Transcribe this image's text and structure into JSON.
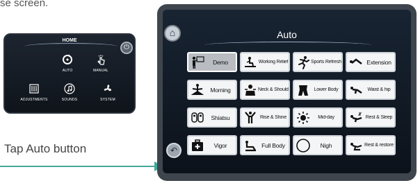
{
  "doc": {
    "top_text": "se screen.",
    "caption": "Tap Auto button"
  },
  "home_screen": {
    "title": "HOME",
    "items": [
      {
        "label": "AUTO",
        "icon": "refresh-icon"
      },
      {
        "label": "MANUAL",
        "icon": "hand-tap-icon"
      },
      {
        "label": "ADJUSTMENTS",
        "icon": "sliders-icon"
      },
      {
        "label": "SOUNDS",
        "icon": "music-note-icon"
      },
      {
        "label": "SYSTEM",
        "icon": "fan-icon"
      }
    ]
  },
  "auto_screen": {
    "title": "Auto",
    "programs": [
      {
        "label": "Demo",
        "icon": "presenter-icon",
        "selected": true
      },
      {
        "label": "Working Relief",
        "icon": "worker-icon"
      },
      {
        "label": "Sports Refresh",
        "icon": "runner-icon"
      },
      {
        "label": "Extension",
        "icon": "stretch-icon"
      },
      {
        "label": "Morning",
        "icon": "yoga-icon"
      },
      {
        "label": "Neck & Shoulder",
        "icon": "neck-shoulder-icon"
      },
      {
        "label": "Lower Body",
        "icon": "lower-body-icon"
      },
      {
        "label": "Waist & hip",
        "icon": "waist-hip-icon"
      },
      {
        "label": "Shiatsu",
        "icon": "fingers-icon"
      },
      {
        "label": "Rise & Shine",
        "icon": "rise-shine-icon"
      },
      {
        "label": "Mid-day",
        "icon": "sun-icon"
      },
      {
        "label": "Rest & Sleep",
        "icon": "sleep-icon"
      },
      {
        "label": "Vigor",
        "icon": "first-aid-icon"
      },
      {
        "label": "Full Body",
        "icon": "full-body-icon"
      },
      {
        "label": "Nigh",
        "icon": "moon-icon"
      },
      {
        "label": "Rest & restore",
        "icon": "recline-icon"
      }
    ]
  }
}
